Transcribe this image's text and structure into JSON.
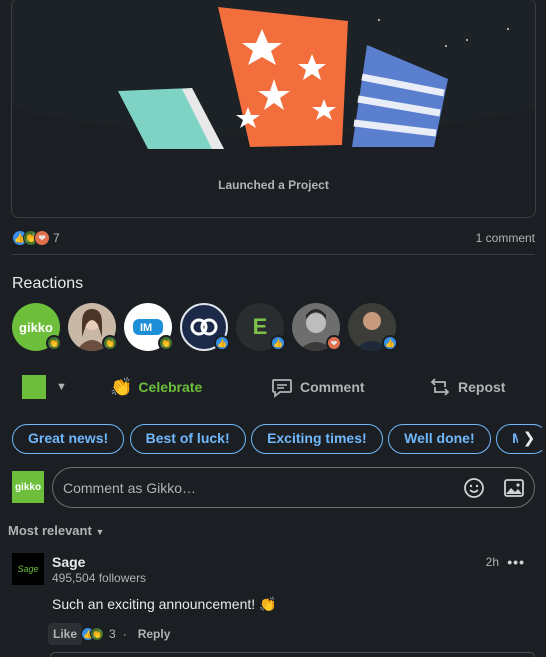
{
  "post": {
    "banner_caption": "Launched a Project",
    "reaction_count": "7",
    "comment_count": "1 comment"
  },
  "reactions": {
    "title": "Reactions",
    "avatars": [
      {
        "label": "gikko",
        "bg": "#6dbf3b",
        "badge": "celebrate"
      },
      {
        "label": "",
        "bg": "#c9b8a6",
        "badge": "celebrate"
      },
      {
        "label": "",
        "bg": "#ffffff",
        "badge": "celebrate"
      },
      {
        "label": "",
        "bg": "#1c2a4a",
        "badge": "like"
      },
      {
        "label": "E",
        "bg": "#2a2d30",
        "badge": "like"
      },
      {
        "label": "",
        "bg": "#6e6e6e",
        "badge": "love"
      },
      {
        "label": "",
        "bg": "#3c3d39",
        "badge": "like"
      }
    ]
  },
  "actions": {
    "celebrate": "Celebrate",
    "comment": "Comment",
    "repost": "Repost"
  },
  "chips": [
    "Great news!",
    "Best of luck!",
    "Exciting times!",
    "Well done!",
    "Mo"
  ],
  "composer": {
    "placeholder": "Comment as Gikko…",
    "logo_text": "gikko"
  },
  "sort": {
    "label": "Most relevant"
  },
  "comment": {
    "author": "Sage",
    "logo_text": "Sage",
    "followers": "495,504 followers",
    "time": "2h",
    "text": "Such an exciting announcement! 👏",
    "like_label": "Like",
    "reaction_count": "3",
    "separator": "·",
    "reply_label": "Reply"
  },
  "colors": {
    "accent_link": "#71b7fb",
    "celebrate_green": "#6dbf3b",
    "background": "#1b1f23"
  }
}
